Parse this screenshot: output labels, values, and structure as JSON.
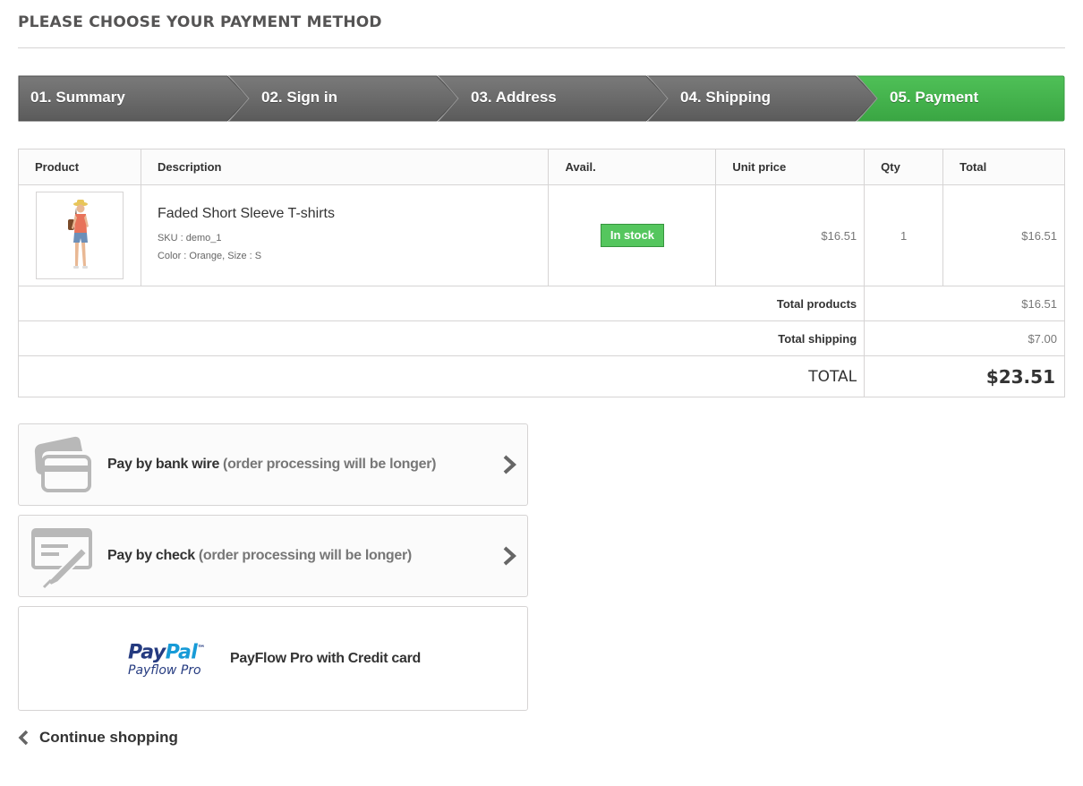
{
  "page": {
    "title": "Please choose your payment method"
  },
  "steps": [
    {
      "label": "01. Summary",
      "active": false
    },
    {
      "label": "02. Sign in",
      "active": false
    },
    {
      "label": "03. Address",
      "active": false
    },
    {
      "label": "04. Shipping",
      "active": false
    },
    {
      "label": "05. Payment",
      "active": true
    }
  ],
  "colors": {
    "step_inactive": "#6b6b6b",
    "step_active": "#46b34f",
    "stock_green": "#55c65e",
    "paypal_dark": "#253b80",
    "paypal_light": "#179bd7"
  },
  "cart": {
    "headers": [
      "Product",
      "Description",
      "Avail.",
      "Unit price",
      "Qty",
      "Total"
    ],
    "items": [
      {
        "name": "Faded Short Sleeve T-shirts",
        "sku": "SKU : demo_1",
        "attributes": "Color : Orange, Size : S",
        "availability": "In stock",
        "unit_price": "$16.51",
        "qty": "1",
        "total": "$16.51"
      }
    ],
    "total_products_label": "Total products",
    "total_products": "$16.51",
    "total_shipping_label": "Total shipping",
    "total_shipping": "$7.00",
    "total_label": "TOTAL",
    "total": "$23.51"
  },
  "payment": {
    "bankwire": {
      "label": "Pay by bank wire",
      "note": "(order processing will be longer)",
      "icon": "bank-card-icon"
    },
    "check": {
      "label": "Pay by check",
      "note": "(order processing will be longer)",
      "icon": "check-sign-icon"
    },
    "paypal": {
      "logo_word_1": "Pay",
      "logo_word_2": "Pal",
      "logo_tm": "™",
      "logo_sub": "Payflow Pro",
      "label": "PayFlow Pro with Credit card"
    }
  },
  "continue_label": "Continue shopping"
}
